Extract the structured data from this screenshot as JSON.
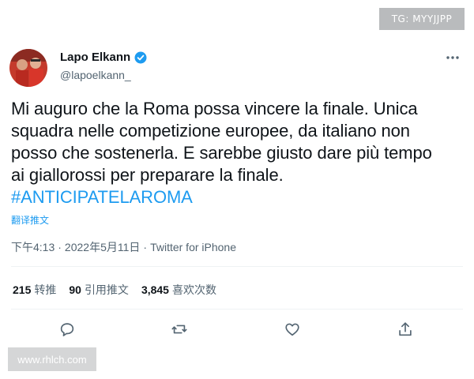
{
  "watermark_top": "TG: MYYJJPP",
  "watermark_bottom": "www.rhlch.com",
  "tweet": {
    "author_name": "Lapo Elkann",
    "handle": "@lapoelkann_",
    "text_lines": [
      "Mi auguro che la Roma possa vincere la finale. Unica",
      "squadra nelle competizione europee, da italiano non",
      "posso che sostenerla. E sarebbe giusto dare più tempo",
      "ai giallorossi per preparare la finale."
    ],
    "hashtag": "#ANTICIPATELAROMA",
    "translate_label": "翻译推文",
    "time": "下午4:13",
    "date": "2022年5月11日",
    "source": "Twitter for iPhone",
    "separator": "·"
  },
  "stats": {
    "retweets_count": "215",
    "retweets_label": "转推",
    "quotes_count": "90",
    "quotes_label": "引用推文",
    "likes_count": "3,845",
    "likes_label": "喜欢次数"
  },
  "icons": {
    "verified": "verified-badge-icon",
    "more": "more-options-icon",
    "reply": "reply-icon",
    "retweet": "retweet-icon",
    "like": "like-icon",
    "share": "share-icon"
  },
  "colors": {
    "accent": "#1d9bf0",
    "text": "#0f1419",
    "secondary": "#536471",
    "divider": "#eff3f4"
  }
}
